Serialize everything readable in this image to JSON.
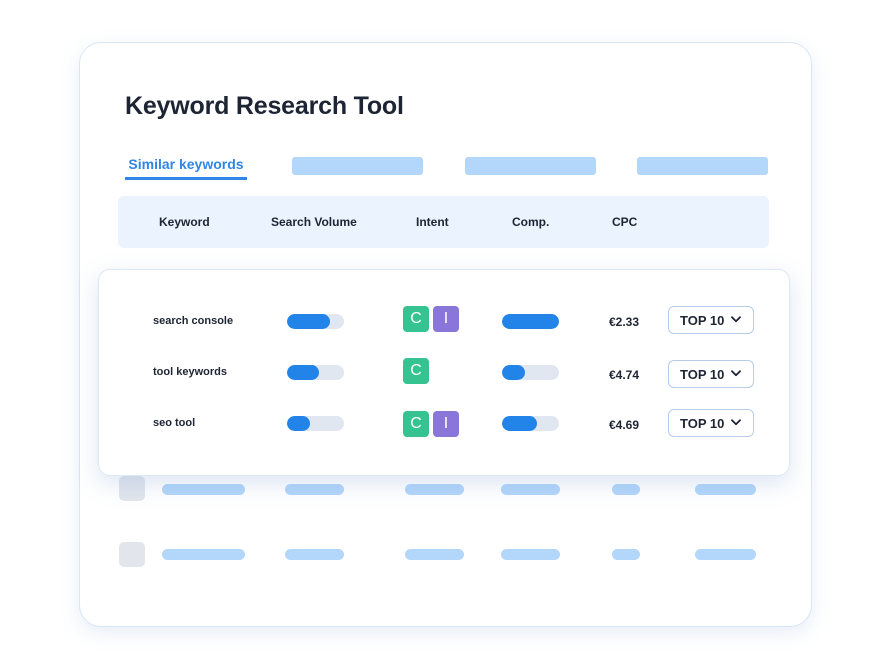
{
  "app": {
    "title": "Keyword Research Tool"
  },
  "tabs": {
    "active_label": "Similar keywords"
  },
  "columns": {
    "keyword": "Keyword",
    "search_volume": "Search Volume",
    "intent": "Intent",
    "comp": "Comp.",
    "cpc": "CPC"
  },
  "rows": [
    {
      "keyword": "search console",
      "search_volume_level": 0.75,
      "intent": [
        "C",
        "I"
      ],
      "comp_level": 1.0,
      "cpc": "€2.33",
      "rank": "TOP 10"
    },
    {
      "keyword": "tool keywords",
      "search_volume_level": 0.57,
      "intent": [
        "C"
      ],
      "comp_level": 0.4,
      "cpc": "€4.74",
      "rank": "TOP 10"
    },
    {
      "keyword": "seo tool",
      "search_volume_level": 0.4,
      "intent": [
        "C",
        "I"
      ],
      "comp_level": 0.62,
      "cpc": "€4.69",
      "rank": "TOP 10"
    }
  ],
  "colors": {
    "accent": "#2f86e6",
    "bar_fill": "#2283e8",
    "bar_track": "#e0e7f1",
    "badge_c": "#35c392",
    "badge_i": "#8a76d8",
    "placeholder": "#b3d6fb"
  },
  "icons": {
    "dropdown": "chevron-down-icon"
  }
}
